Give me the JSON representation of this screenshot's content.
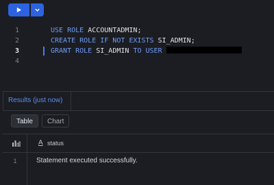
{
  "toolbar": {
    "run_icon": "play-icon",
    "menu_icon": "chevron-down-icon",
    "accent": "#2d63e0"
  },
  "editor": {
    "lines": [
      {
        "num": "1",
        "kw1": "USE ROLE",
        "text1": " ACCOUNTADMIN;"
      },
      {
        "num": "2",
        "kw1": "CREATE ROLE IF NOT EXISTS",
        "text1": " SI_ADMIN;"
      },
      {
        "num": "3",
        "kw1": "GRANT ROLE",
        "text1": " SI_ADMIN ",
        "kw2": "TO USER"
      },
      {
        "num": "4"
      }
    ],
    "keyword_color": "#6f9cf7"
  },
  "results": {
    "tab_label": "Results (just now)",
    "view_table": "Table",
    "view_chart": "Chart",
    "columns": [
      {
        "type_icon": "A",
        "name": "status"
      }
    ],
    "rows": [
      {
        "num": "1",
        "status": "Statement executed successfully."
      }
    ]
  }
}
